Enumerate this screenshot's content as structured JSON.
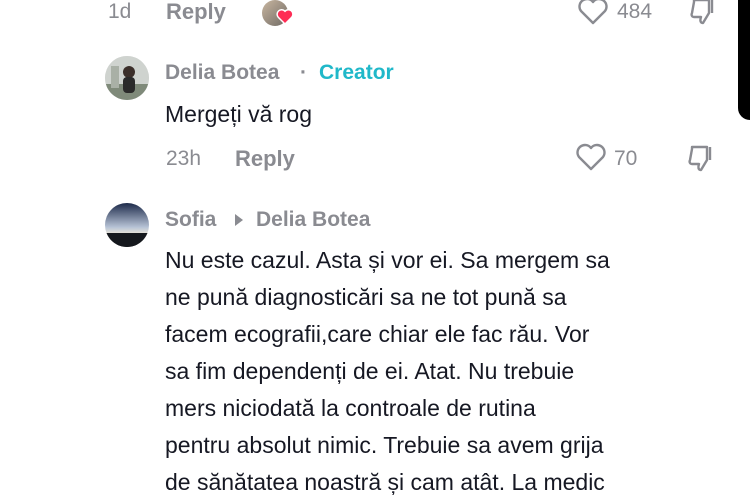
{
  "top_comment": {
    "time": "1d",
    "reply_label": "Reply",
    "like_count": "484"
  },
  "reply1": {
    "author": "Delia Botea",
    "separator": "·",
    "badge": "Creator",
    "text": "Mergeți vă rog",
    "time": "23h",
    "reply_label": "Reply",
    "like_count": "70"
  },
  "reply2": {
    "author": "Sofia",
    "reply_to": "Delia Botea",
    "lines": [
      "Nu este cazul. Asta și vor ei. Sa mergem sa",
      "ne pună diagnosticări sa ne tot pună sa",
      "facem ecografii,care chiar ele fac rău. Vor",
      "sa fim dependenți de ei. Atat. Nu trebuie",
      "mers niciodată la controale de rutina",
      "pentru absolut nimic. Trebuie sa avem grija",
      "de sănătatea noastră și cam atât. La medic"
    ]
  },
  "colors": {
    "accent_creator": "#20b8c9",
    "muted": "#8a8b91",
    "text": "#161823",
    "like_heart": "#fe2c55"
  }
}
